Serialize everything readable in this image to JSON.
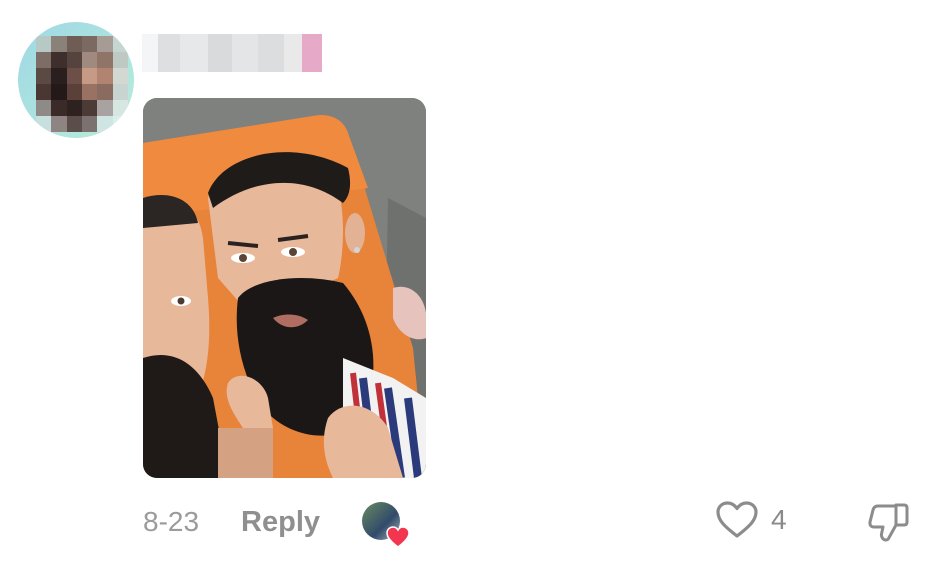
{
  "comment": {
    "avatar_icon": "user-avatar-pixelated",
    "username_icon": "pixelated-username",
    "date": "8-23",
    "reply_label": "Reply",
    "like_count": "4",
    "creator_liked_icon": "creator-avatar-heart",
    "like_icon": "heart-outline-icon",
    "dislike_icon": "thumbs-down-icon",
    "heart_color": "#f2364f"
  }
}
